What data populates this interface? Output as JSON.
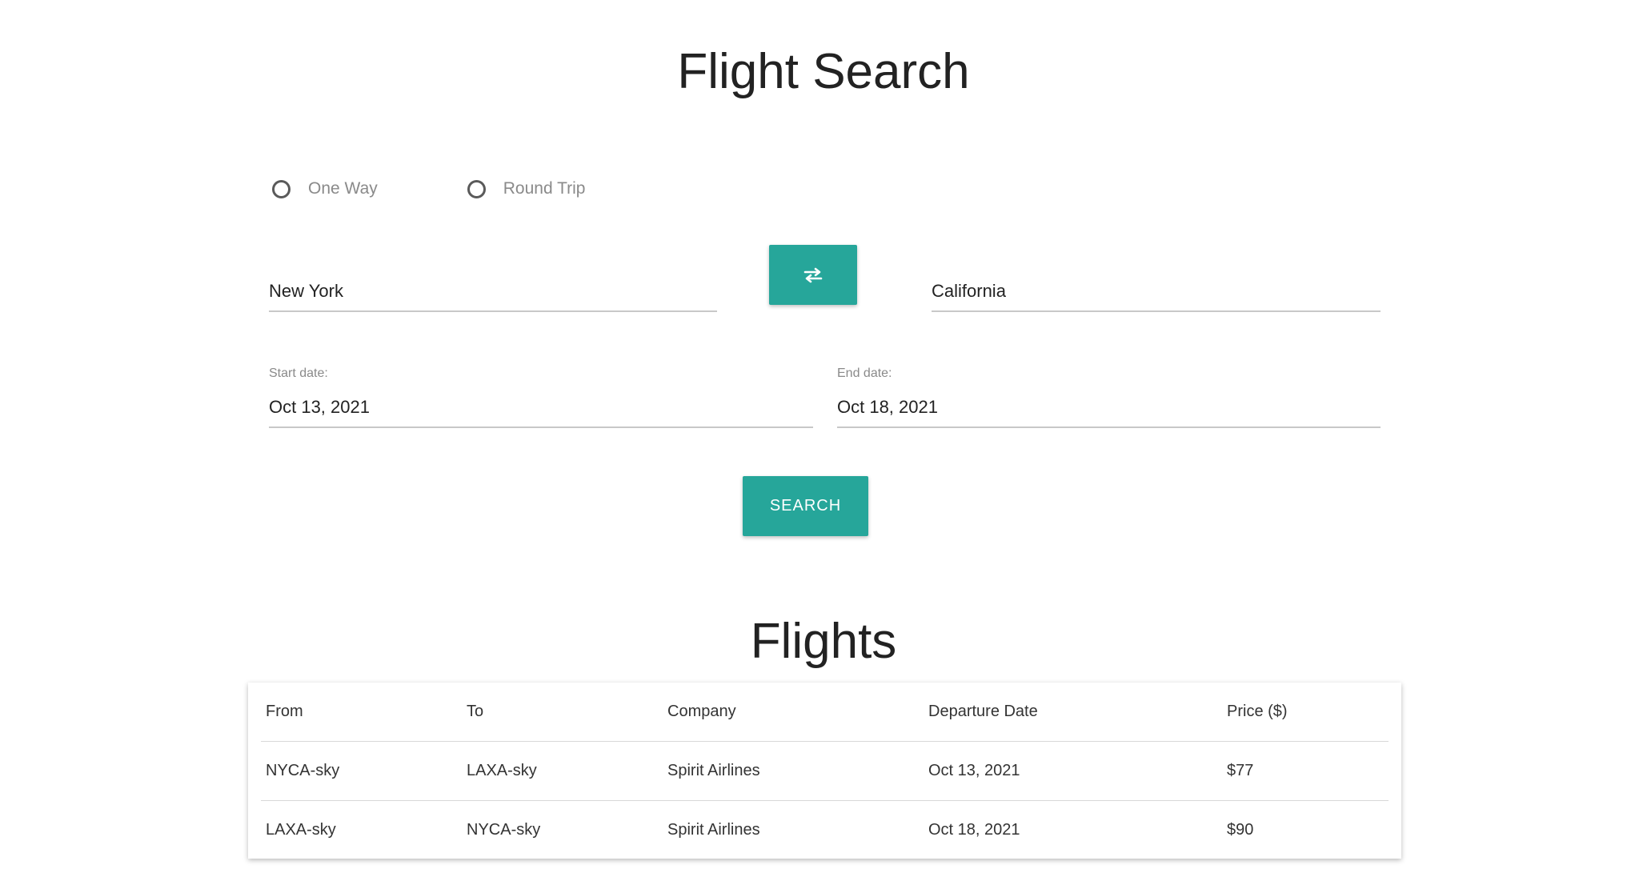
{
  "header": {
    "title": "Flight Search"
  },
  "trip_type": {
    "options": [
      {
        "label": "One Way"
      },
      {
        "label": "Round Trip"
      }
    ]
  },
  "route": {
    "from_value": "New York",
    "to_value": "California",
    "swap_icon": "swap-arrows-icon"
  },
  "dates": {
    "start_label": "Start date:",
    "start_value": "Oct 13, 2021",
    "end_label": "End date:",
    "end_value": "Oct 18, 2021"
  },
  "search": {
    "button_label": "SEARCH"
  },
  "results": {
    "title": "Flights",
    "columns": [
      "From",
      "To",
      "Company",
      "Departure Date",
      "Price ($)"
    ],
    "rows": [
      [
        "NYCA-sky",
        "LAXA-sky",
        "Spirit Airlines",
        "Oct 13, 2021",
        "$77"
      ],
      [
        "LAXA-sky",
        "NYCA-sky",
        "Spirit Airlines",
        "Oct 18, 2021",
        "$90"
      ]
    ]
  },
  "colors": {
    "accent": "#26a69a",
    "text": "#222222",
    "muted": "#8a8a8a",
    "divider": "#d8d8d8"
  }
}
